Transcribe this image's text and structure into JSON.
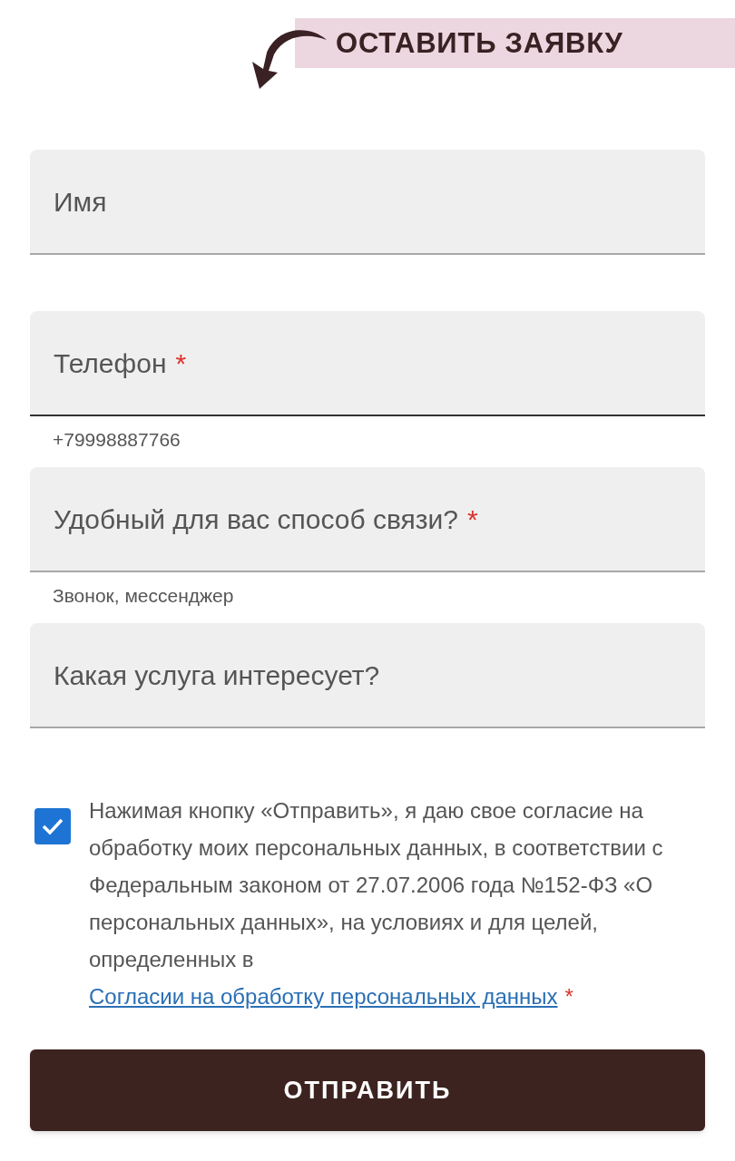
{
  "header": {
    "title": "ОСТАВИТЬ ЗАЯВКУ"
  },
  "fields": [
    {
      "label": "Имя",
      "focused": false
    },
    {
      "label": "Телефон",
      "mark": "*",
      "focused": true,
      "hint": "+79998887766"
    },
    {
      "label": "Удобный для вас способ связи?",
      "mark": "*",
      "focused": false,
      "hint": "Звонок, мессенджер"
    },
    {
      "label": "Какая услуга интересует?",
      "focused": false
    }
  ],
  "consent": {
    "checked": true,
    "text": "Нажимая кнопку «Отправить», я даю свое согласие на обработку моих персональных данных, в соответствии с Федеральным законом от 27.07.2006 года №152-ФЗ «О персональных данных», на условиях и для целей, определенных в",
    "link": "Согласии на обработку персональных данных",
    "mark": "*"
  },
  "submit": {
    "label": "ОТПРАВИТЬ"
  }
}
